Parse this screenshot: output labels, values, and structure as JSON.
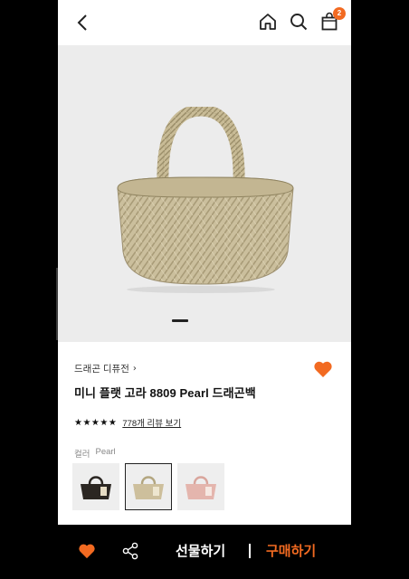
{
  "colors": {
    "accent": "#f26a21",
    "hero_bg": "#ececec",
    "bottom_bar": "#000000"
  },
  "header": {
    "icons": [
      "chevron-left-icon",
      "home-icon",
      "search-icon",
      "shopping-bag-icon"
    ],
    "cart_count": "2"
  },
  "gallery": {
    "current_page": 1
  },
  "product": {
    "brand": "드래곤 디퓨전",
    "brand_chevron": "›",
    "title": "미니 플랫 고라 8809 Pearl 드래곤백",
    "stars": "★★★★★",
    "rating": 5,
    "review_link": "778개 리뷰 보기",
    "color_label": "컬러",
    "color_value": "Pearl",
    "swatches": [
      {
        "name": "black",
        "hex": "#2b2622"
      },
      {
        "name": "pearl",
        "hex": "#cdbf9c",
        "selected": true
      },
      {
        "name": "pink",
        "hex": "#e4b5ad"
      }
    ]
  },
  "bottom_bar": {
    "gift_label": "선물하기",
    "buy_label": "구매하기"
  }
}
